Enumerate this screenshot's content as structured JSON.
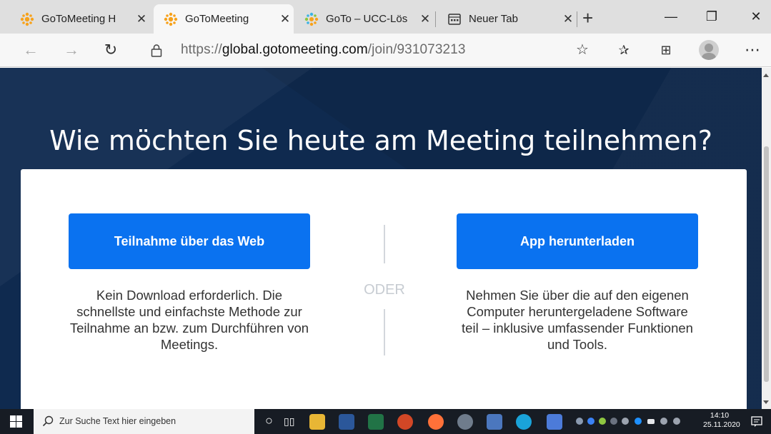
{
  "browser": {
    "tabs": [
      {
        "title": "GoToMeeting H",
        "active": false
      },
      {
        "title": "GoToMeeting",
        "active": true
      },
      {
        "title": "GoTo – UCC-Lös",
        "active": false
      },
      {
        "title": "Neuer Tab",
        "active": false
      }
    ],
    "url_prefix": "https://",
    "url_domain": "global.gotomeeting.com",
    "url_path": "/join/931073213"
  },
  "page": {
    "heading": "Wie möchten Sie heute am Meeting teilnehmen?",
    "web_button": "Teilnahme über das Web",
    "web_description": "Kein Download erforderlich. Die schnellste und einfachste Methode zur Teilnahme an bzw. zum Durchführen von Meetings.",
    "separator": "ODER",
    "app_button": "App herunterladen",
    "app_description": "Nehmen Sie über die auf den eigenen Computer heruntergeladene Software teil – inklusive umfassender Funktionen und Tools."
  },
  "taskbar": {
    "search_placeholder": "Zur Suche Text hier eingeben",
    "time": "14:10",
    "date": "25.11.2020"
  },
  "colors": {
    "accent": "#0a72f0",
    "page_bg": "#0f2a4f",
    "favicon": "#f7a21b"
  }
}
